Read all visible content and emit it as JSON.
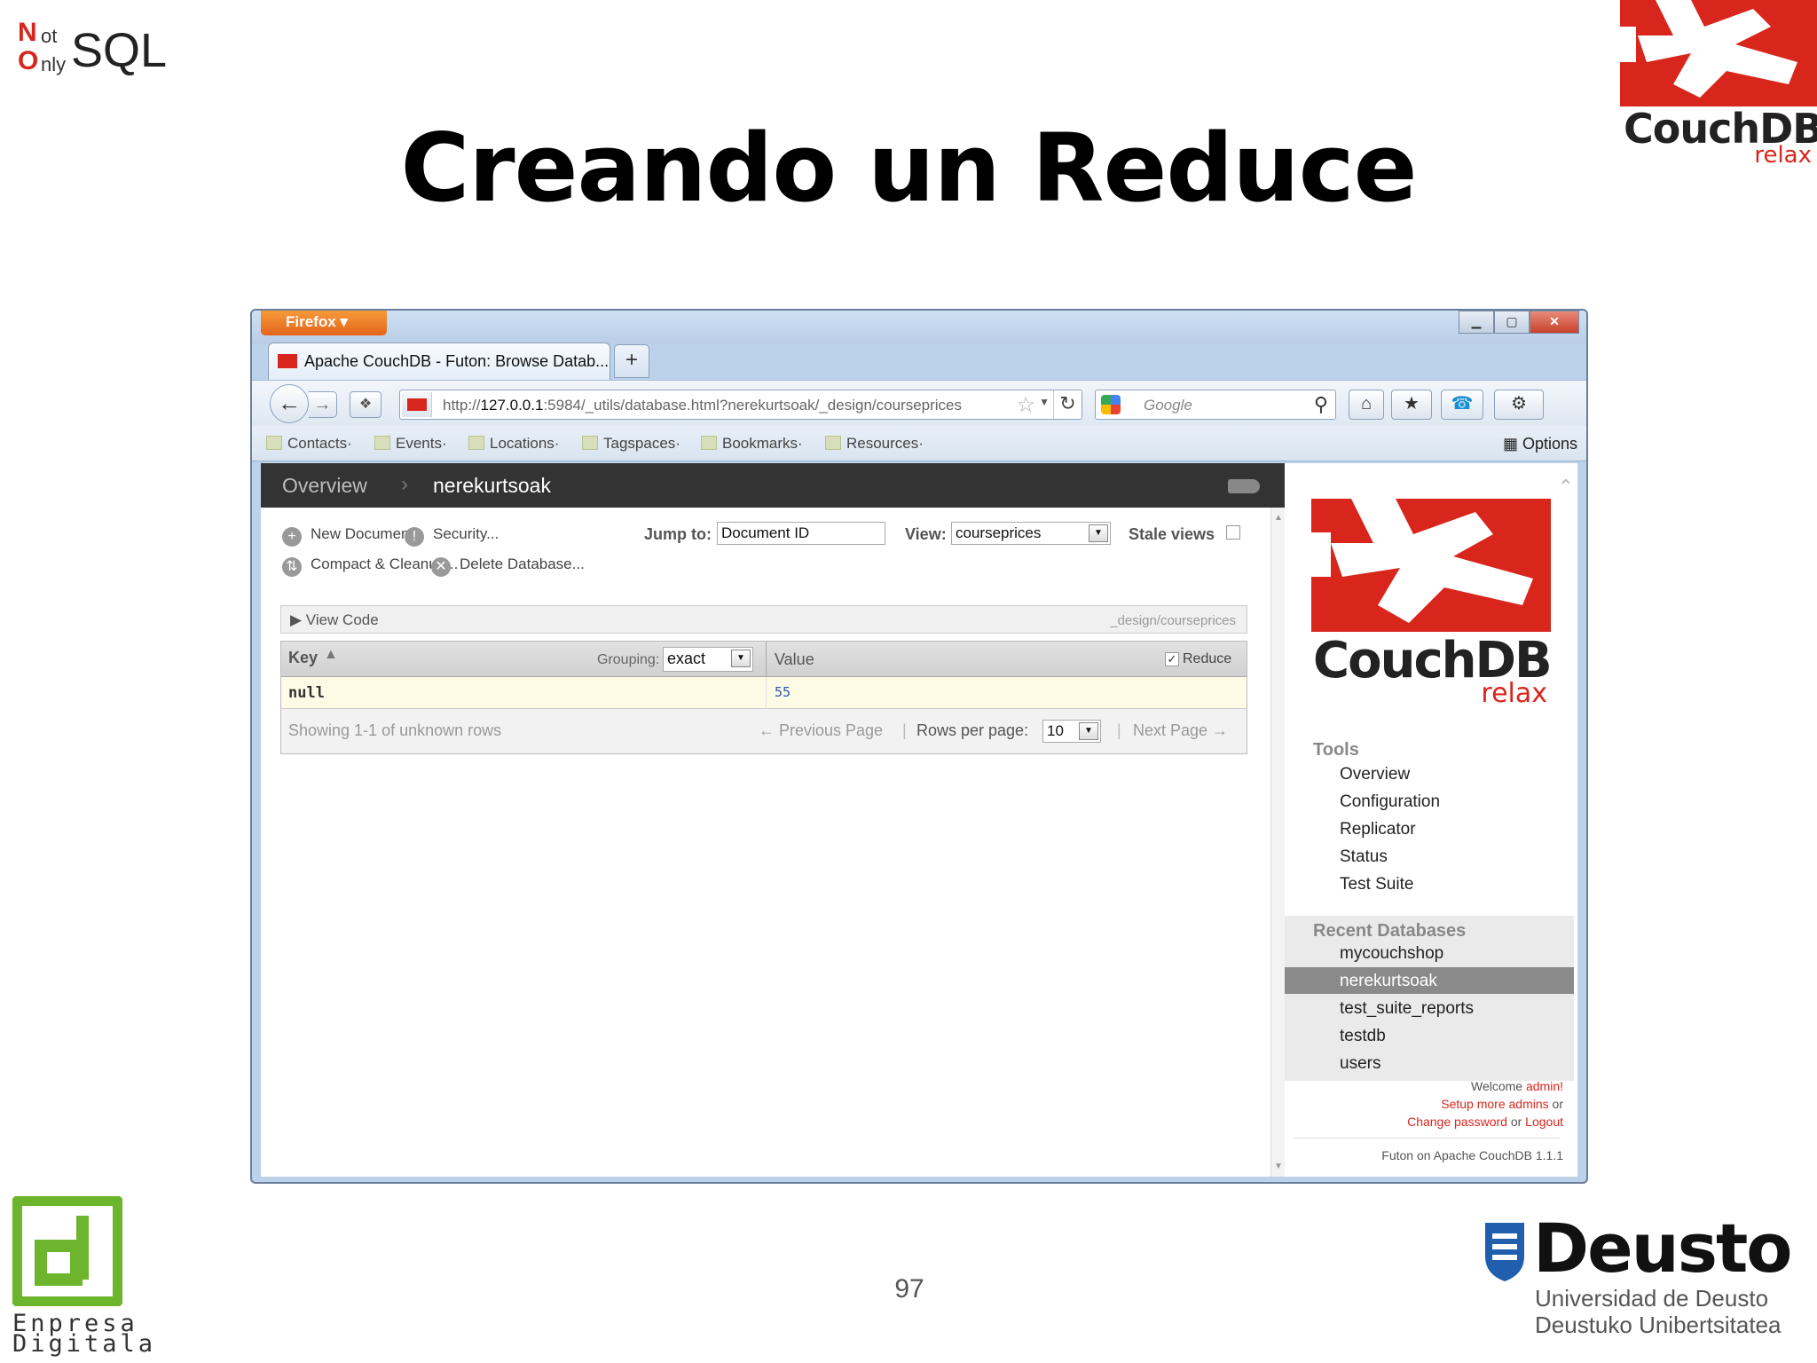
{
  "slide": {
    "logo_not": "N",
    "logo_ot": "ot",
    "logo_only": "O",
    "logo_nly": "nly",
    "logo_sql": "SQL",
    "title": "Creando un Reduce",
    "couchdb_logo_word": "CouchDB",
    "couchdb_logo_relax": "relax",
    "page_number": "97",
    "empresa_digitala": "Enpresa\nDigitala",
    "deusto_name": "Deusto",
    "deusto_sub1": "Universidad de Deusto",
    "deusto_sub2": "Deustuko Unibertsitatea"
  },
  "browser": {
    "app_button": "Firefox ▾",
    "window_controls": [
      "▁",
      "▢",
      "✕"
    ],
    "tab_title": "Apache CouchDB - Futon: Browse Datab...",
    "new_tab": "+",
    "url_prefix": "http://",
    "url_host": "127.0.0.1",
    "url_rest": ":5984/_utils/database.html?nerekurtsoak/_design/courseprices",
    "search_placeholder": "Google",
    "bookmarks": [
      "Contacts·",
      "Events·",
      "Locations·",
      "Tagspaces·",
      "Bookmarks·",
      "Resources·"
    ],
    "options_label": "Options"
  },
  "futon": {
    "breadcrumb_overview": "Overview",
    "breadcrumb_sep": "›",
    "breadcrumb_db": "nerekurtsoak",
    "actions": {
      "new_document": "New Document",
      "security": "Security...",
      "compact": "Compact & Cleanup...",
      "delete_db": "Delete Database..."
    },
    "jump_to_label": "Jump to:",
    "jump_to_value": "Document ID",
    "view_label": "View:",
    "view_value": "courseprices",
    "stale_views_label": "Stale views",
    "view_code_label": "▶  View Code",
    "design_path": "_design/courseprices",
    "grid": {
      "key_header": "Key",
      "grouping_label": "Grouping:",
      "grouping_value": "exact",
      "value_header": "Value",
      "reduce_label": "Reduce",
      "reduce_checked": true,
      "rows": [
        {
          "key": "null",
          "value": "55"
        }
      ],
      "showing": "Showing 1-1 of unknown rows",
      "prev_page": "← Previous Page",
      "rows_per_page_label": "Rows per page:",
      "rows_per_page_value": "10",
      "next_page": "Next Page →"
    },
    "sidebar": {
      "logo_word": "CouchDB",
      "logo_relax": "relax",
      "tools_heading": "Tools",
      "tools": [
        "Overview",
        "Configuration",
        "Replicator",
        "Status",
        "Test Suite"
      ],
      "recent_heading": "Recent Databases",
      "recent": [
        "mycouchshop",
        "nerekurtsoak",
        "test_suite_reports",
        "testdb",
        "users"
      ],
      "selected_recent": "nerekurtsoak",
      "welcome": "Welcome",
      "user": "admin!",
      "setup_admins": "Setup more admins",
      "or1": "or",
      "change_password": "Change password",
      "or2": "or",
      "logout": "Logout",
      "footer": "Futon on Apache CouchDB 1.1.1"
    }
  },
  "colors": {
    "couch_red": "#d9261c",
    "firefox_orange": "#e3651b",
    "breadcrumb_dark": "#333333",
    "row_highlight": "#fdfbe6"
  }
}
